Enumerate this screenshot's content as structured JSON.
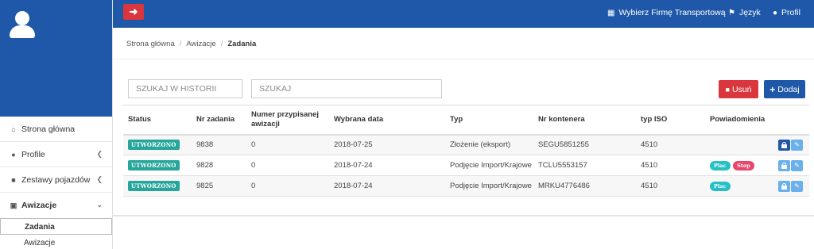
{
  "topbar": {
    "back_icon": "arrow-left-icon",
    "links": [
      {
        "label": "Wybierz Firmę Transportową",
        "icon": "building-icon"
      },
      {
        "label": "Język",
        "icon": "flag-icon"
      },
      {
        "label": "Profil",
        "icon": "user-icon"
      }
    ]
  },
  "sidebar": {
    "items": [
      {
        "label": "Strona główna",
        "icon": "home-icon"
      },
      {
        "label": "Profile",
        "icon": "users-icon"
      },
      {
        "label": "Zestawy pojazdów",
        "icon": "truck-icon"
      },
      {
        "label": "Awizacje",
        "icon": "calendar-icon"
      }
    ],
    "subitems": [
      {
        "label": "Zadania"
      },
      {
        "label": "Awizacje"
      }
    ]
  },
  "breadcrumb": [
    "Strona główna",
    "Awizacje",
    "Zadania"
  ],
  "search": {
    "history_placeholder": "SZUKAJ W HISTORII",
    "search_placeholder": "SZUKAJ"
  },
  "actions": {
    "delete_label": "Usuń",
    "add_label": "Dodaj"
  },
  "table": {
    "headers": [
      "Status",
      "Nr zadania",
      "Numer przypisanej awizacji",
      "Wybrana data",
      "Typ",
      "Nr kontenera",
      "typ ISO",
      "Powiadomienia"
    ],
    "rows": [
      {
        "status": "UTWORZONO",
        "nr": "9838",
        "awizacja": "0",
        "data": "2018-07-25",
        "typ": "Złożenie (eksport)",
        "kontener": "SEGU5851255",
        "iso": "4510",
        "pills": [],
        "lock": "dark"
      },
      {
        "status": "UTWORZONO",
        "nr": "9828",
        "awizacja": "0",
        "data": "2018-07-24",
        "typ": "Podjęcie Import/Krajowe",
        "kontener": "TCLU5553157",
        "iso": "4510",
        "pills": [
          "Plac",
          "Stop"
        ],
        "lock": "light"
      },
      {
        "status": "UTWORZONO",
        "nr": "9825",
        "awizacja": "0",
        "data": "2018-07-24",
        "typ": "Podjęcie Import/Krajowe",
        "kontener": "MRKU4776486",
        "iso": "4510",
        "pills": [
          "Plac"
        ],
        "lock": "light"
      }
    ]
  },
  "colors": {
    "brand_blue": "#1f58a8",
    "danger_red": "#d9363e",
    "status_green": "#26a69a",
    "plac_teal": "#26bfc4",
    "stop_pink": "#e8466c"
  }
}
